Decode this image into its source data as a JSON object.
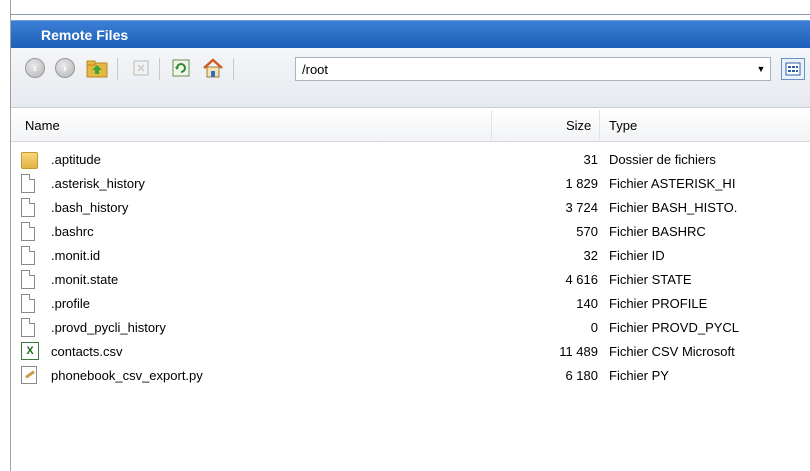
{
  "window": {
    "title": "Remote Files"
  },
  "toolbar": {
    "path": "/root",
    "icons": [
      "back-icon",
      "forward-icon",
      "up-folder-icon",
      "delete-icon",
      "refresh-icon",
      "home-icon",
      "view-icon"
    ]
  },
  "columns": {
    "name": "Name",
    "size": "Size",
    "type": "Type"
  },
  "files": [
    {
      "icon": "folder-icon",
      "name": ".aptitude",
      "size": "31",
      "type": "Dossier de fichiers"
    },
    {
      "icon": "file-icon",
      "name": ".asterisk_history",
      "size": "1 829",
      "type": "Fichier ASTERISK_HI"
    },
    {
      "icon": "file-icon",
      "name": ".bash_history",
      "size": "3 724",
      "type": "Fichier BASH_HISTO."
    },
    {
      "icon": "file-icon",
      "name": ".bashrc",
      "size": "570",
      "type": "Fichier BASHRC"
    },
    {
      "icon": "file-icon",
      "name": ".monit.id",
      "size": "32",
      "type": "Fichier ID"
    },
    {
      "icon": "file-icon",
      "name": ".monit.state",
      "size": "4 616",
      "type": "Fichier STATE"
    },
    {
      "icon": "file-icon",
      "name": ".profile",
      "size": "140",
      "type": "Fichier PROFILE"
    },
    {
      "icon": "file-icon",
      "name": ".provd_pycli_history",
      "size": "0",
      "type": "Fichier PROVD_PYCL"
    },
    {
      "icon": "excel-icon",
      "name": "contacts.csv",
      "size": "11 489",
      "type": "Fichier CSV Microsoft"
    },
    {
      "icon": "python-file-icon",
      "name": "phonebook_csv_export.py",
      "size": "6 180",
      "type": "Fichier PY"
    }
  ]
}
